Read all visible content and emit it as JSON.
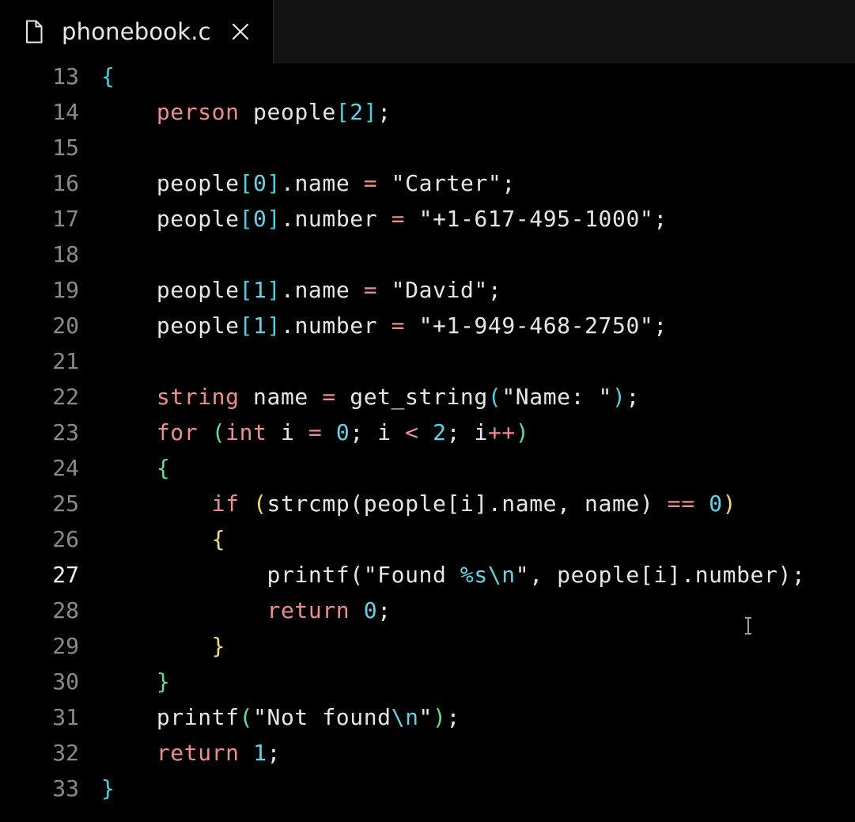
{
  "tab": {
    "filename": "phonebook.c",
    "file_icon": "file-icon",
    "close_icon": "close-icon"
  },
  "editor": {
    "active_line": "27",
    "lines": [
      {
        "n": "13",
        "tokens": [
          [
            "{",
            "b1"
          ]
        ]
      },
      {
        "n": "14",
        "tokens": [
          [
            "    ",
            "plain"
          ],
          [
            "person",
            "kw"
          ],
          [
            " people",
            "plain"
          ],
          [
            "[",
            "b1"
          ],
          [
            "2",
            "num"
          ],
          [
            "]",
            "b1"
          ],
          [
            ";",
            "plain"
          ]
        ]
      },
      {
        "n": "15",
        "tokens": []
      },
      {
        "n": "16",
        "tokens": [
          [
            "    people",
            "plain"
          ],
          [
            "[",
            "b1"
          ],
          [
            "0",
            "num"
          ],
          [
            "]",
            "b1"
          ],
          [
            ".name ",
            "plain"
          ],
          [
            "=",
            "op"
          ],
          [
            " \"Carter\";",
            "plain"
          ]
        ]
      },
      {
        "n": "17",
        "tokens": [
          [
            "    people",
            "plain"
          ],
          [
            "[",
            "b1"
          ],
          [
            "0",
            "num"
          ],
          [
            "]",
            "b1"
          ],
          [
            ".number ",
            "plain"
          ],
          [
            "=",
            "op"
          ],
          [
            " \"+1-617-495-1000\";",
            "plain"
          ]
        ]
      },
      {
        "n": "18",
        "tokens": []
      },
      {
        "n": "19",
        "tokens": [
          [
            "    people",
            "plain"
          ],
          [
            "[",
            "b1"
          ],
          [
            "1",
            "num"
          ],
          [
            "]",
            "b1"
          ],
          [
            ".name ",
            "plain"
          ],
          [
            "=",
            "op"
          ],
          [
            " \"David\";",
            "plain"
          ]
        ]
      },
      {
        "n": "20",
        "tokens": [
          [
            "    people",
            "plain"
          ],
          [
            "[",
            "b1"
          ],
          [
            "1",
            "num"
          ],
          [
            "]",
            "b1"
          ],
          [
            ".number ",
            "plain"
          ],
          [
            "=",
            "op"
          ],
          [
            " \"+1-949-468-2750\";",
            "plain"
          ]
        ]
      },
      {
        "n": "21",
        "tokens": []
      },
      {
        "n": "22",
        "tokens": [
          [
            "    ",
            "plain"
          ],
          [
            "string",
            "kw"
          ],
          [
            " name ",
            "plain"
          ],
          [
            "=",
            "op"
          ],
          [
            " get_string",
            "plain"
          ],
          [
            "(",
            "b1"
          ],
          [
            "\"Name: \"",
            "plain"
          ],
          [
            ")",
            "b1"
          ],
          [
            ";",
            "plain"
          ]
        ]
      },
      {
        "n": "23",
        "tokens": [
          [
            "    ",
            "plain"
          ],
          [
            "for",
            "kw"
          ],
          [
            " ",
            "plain"
          ],
          [
            "(",
            "b2"
          ],
          [
            "int",
            "kw"
          ],
          [
            " i ",
            "plain"
          ],
          [
            "=",
            "op"
          ],
          [
            " ",
            "plain"
          ],
          [
            "0",
            "num"
          ],
          [
            "; i ",
            "plain"
          ],
          [
            "<",
            "op"
          ],
          [
            " ",
            "plain"
          ],
          [
            "2",
            "num"
          ],
          [
            "; i",
            "plain"
          ],
          [
            "++",
            "op"
          ],
          [
            ")",
            "b2"
          ]
        ]
      },
      {
        "n": "24",
        "tokens": [
          [
            "    ",
            "plain"
          ],
          [
            "{",
            "b2"
          ]
        ]
      },
      {
        "n": "25",
        "tokens": [
          [
            "        ",
            "plain"
          ],
          [
            "if",
            "kw"
          ],
          [
            " ",
            "plain"
          ],
          [
            "(",
            "b3"
          ],
          [
            "strcmp(people[i].name, name) ",
            "plain"
          ],
          [
            "==",
            "op"
          ],
          [
            " ",
            "plain"
          ],
          [
            "0",
            "num"
          ],
          [
            ")",
            "b3"
          ]
        ]
      },
      {
        "n": "26",
        "tokens": [
          [
            "        ",
            "plain"
          ],
          [
            "{",
            "b3"
          ]
        ]
      },
      {
        "n": "27",
        "tokens": [
          [
            "            printf(\"Found ",
            "plain"
          ],
          [
            "%s\\n",
            "esc"
          ],
          [
            "\", people[i].number)",
            "plain"
          ],
          [
            ";",
            "plain"
          ]
        ]
      },
      {
        "n": "28",
        "tokens": [
          [
            "            ",
            "plain"
          ],
          [
            "return",
            "ret"
          ],
          [
            " ",
            "plain"
          ],
          [
            "0",
            "num"
          ],
          [
            ";",
            "plain"
          ]
        ]
      },
      {
        "n": "29",
        "tokens": [
          [
            "        ",
            "plain"
          ],
          [
            "}",
            "b3"
          ]
        ]
      },
      {
        "n": "30",
        "tokens": [
          [
            "    ",
            "plain"
          ],
          [
            "}",
            "b2"
          ]
        ]
      },
      {
        "n": "31",
        "tokens": [
          [
            "    printf",
            "plain"
          ],
          [
            "(",
            "b2"
          ],
          [
            "\"Not found",
            "plain"
          ],
          [
            "\\n",
            "esc"
          ],
          [
            "\"",
            "plain"
          ],
          [
            ")",
            "b2"
          ],
          [
            ";",
            "plain"
          ]
        ]
      },
      {
        "n": "32",
        "tokens": [
          [
            "    ",
            "plain"
          ],
          [
            "return",
            "ret"
          ],
          [
            " ",
            "plain"
          ],
          [
            "1",
            "num"
          ],
          [
            ";",
            "plain"
          ]
        ]
      },
      {
        "n": "33",
        "tokens": [
          [
            "}",
            "b1"
          ]
        ]
      }
    ]
  },
  "cursor_icon": "ibeam-cursor-icon"
}
